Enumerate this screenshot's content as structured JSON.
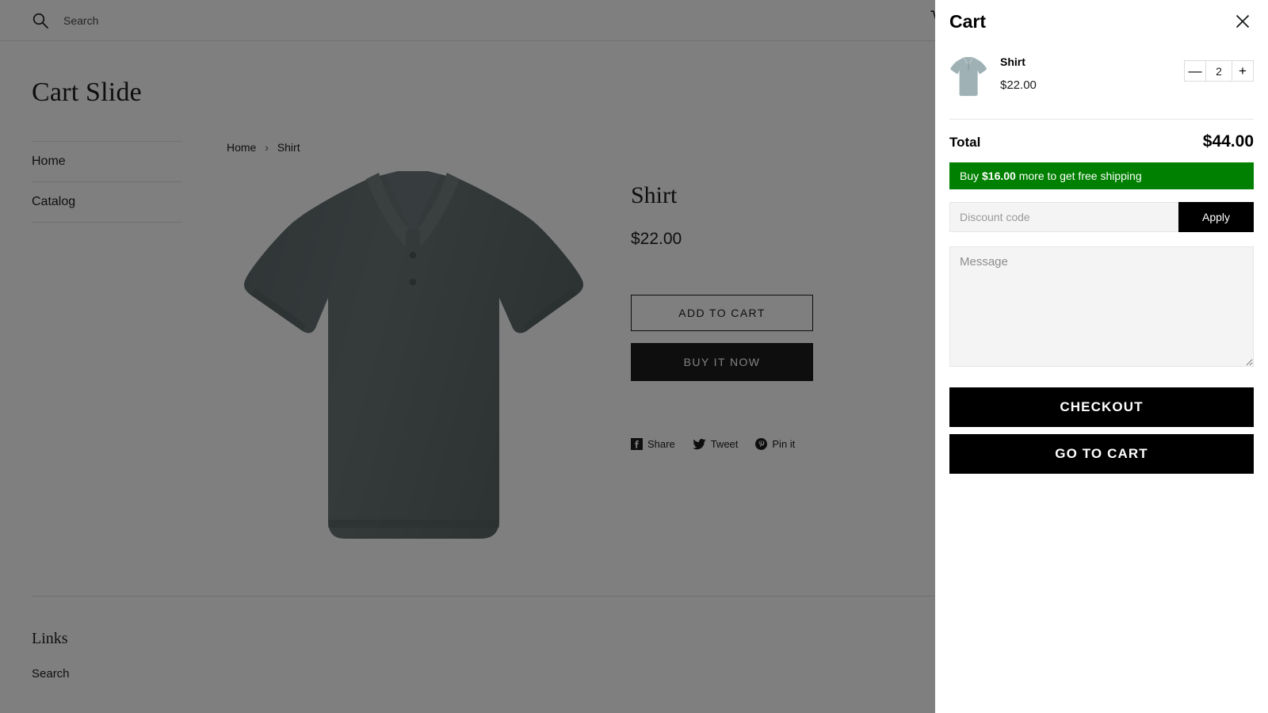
{
  "header": {
    "search_placeholder": "Search",
    "search_value": "",
    "search_icon": "search-icon",
    "cart_icon": "shopping-cart-icon"
  },
  "site": {
    "title": "Cart Slide"
  },
  "sidebar": {
    "items": [
      {
        "label": "Home"
      },
      {
        "label": "Catalog"
      }
    ]
  },
  "breadcrumb": {
    "home": "Home",
    "separator": "›",
    "current": "Shirt"
  },
  "product": {
    "title": "Shirt",
    "price": "$22.00",
    "add_to_cart_label": "ADD TO CART",
    "buy_now_label": "BUY IT NOW",
    "image_alt": "shirt-product-image",
    "share": [
      {
        "label": "Share",
        "icon": "facebook-icon"
      },
      {
        "label": "Tweet",
        "icon": "twitter-icon"
      },
      {
        "label": "Pin it",
        "icon": "pinterest-icon"
      }
    ]
  },
  "footer": {
    "title": "Links",
    "links": [
      {
        "label": "Search"
      }
    ]
  },
  "cart": {
    "title": "Cart",
    "close_icon": "close-icon",
    "items": [
      {
        "name": "Shirt",
        "price": "$22.00",
        "quantity": "2",
        "decrease_label": "—",
        "increase_label": "+",
        "thumb_alt": "shirt-thumbnail"
      }
    ],
    "total_label": "Total",
    "total_value": "$44.00",
    "shipping_notice": {
      "prefix": "Buy ",
      "amount": "$16.00",
      "suffix": " more to get free shipping",
      "background": "#008000",
      "text_color": "#ffffff"
    },
    "discount_placeholder": "Discount code",
    "discount_value": "",
    "apply_label": "Apply",
    "message_placeholder": "Message",
    "message_value": "",
    "checkout_label": "CHECKOUT",
    "go_to_cart_label": "GO TO CART"
  },
  "theme": {
    "accent": "#000000",
    "text": "#1c1d1d",
    "border": "#e0e0e0",
    "overlay": "rgba(0,0,0,0.5)",
    "field_bg": "#f4f4f4"
  }
}
